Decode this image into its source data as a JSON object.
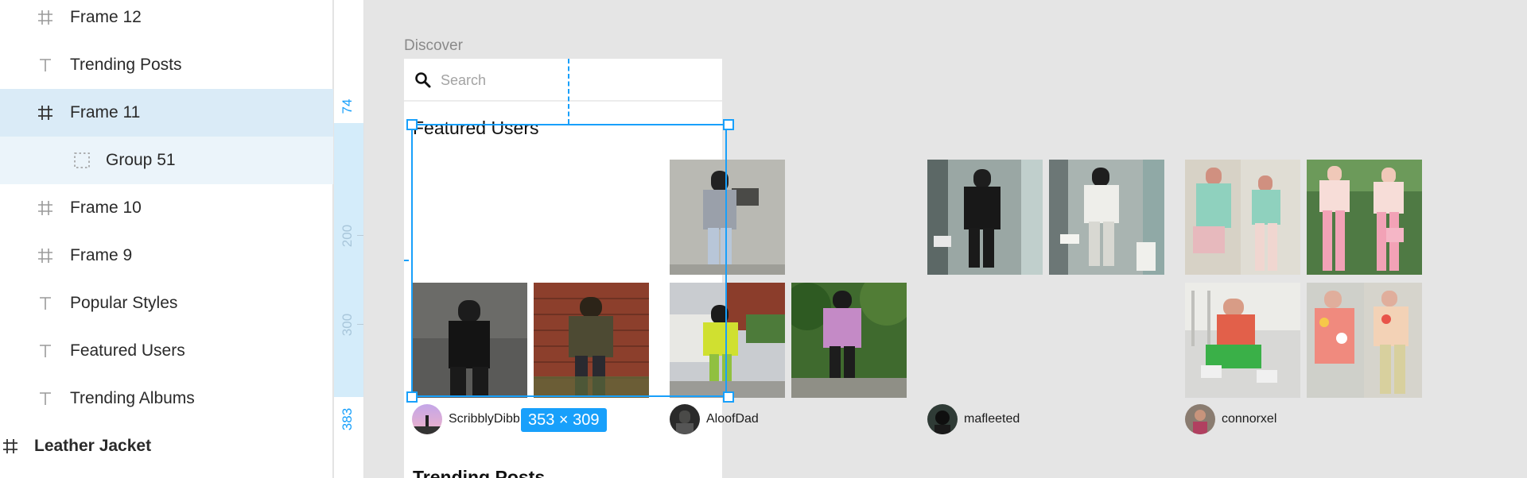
{
  "layers": [
    {
      "label": "Frame 12",
      "icon": "frame-icon",
      "state": "normal"
    },
    {
      "label": "Trending Posts",
      "icon": "text-icon",
      "state": "normal"
    },
    {
      "label": "Frame 11",
      "icon": "frame-icon",
      "state": "selected"
    },
    {
      "label": "Group 51",
      "icon": "group-icon",
      "state": "child-selected"
    },
    {
      "label": "Frame 10",
      "icon": "frame-icon",
      "state": "normal"
    },
    {
      "label": "Frame 9",
      "icon": "frame-icon",
      "state": "normal"
    },
    {
      "label": "Popular Styles",
      "icon": "text-icon",
      "state": "normal"
    },
    {
      "label": "Featured Users",
      "icon": "text-icon",
      "state": "normal"
    },
    {
      "label": "Trending Albums",
      "icon": "text-icon",
      "state": "normal"
    },
    {
      "label": "Leather Jacket",
      "icon": "frame-icon",
      "state": "normal"
    }
  ],
  "ruler": {
    "labels": [
      "74",
      "200",
      "300",
      "383"
    ]
  },
  "canvas": {
    "frame_title": "Discover",
    "search_placeholder": "Search",
    "featured_heading": "Featured Users",
    "trending_heading": "Trending Posts",
    "selection_size": "353 × 309"
  },
  "users": [
    {
      "name": "ScribblyDibb"
    },
    {
      "name": "AloofDad"
    },
    {
      "name": "mafleeted"
    },
    {
      "name": "connorxel"
    }
  ],
  "colors": {
    "accent": "#18a0fb",
    "selected_layer": "#daebf7",
    "canvas_bg": "#e5e5e5"
  }
}
